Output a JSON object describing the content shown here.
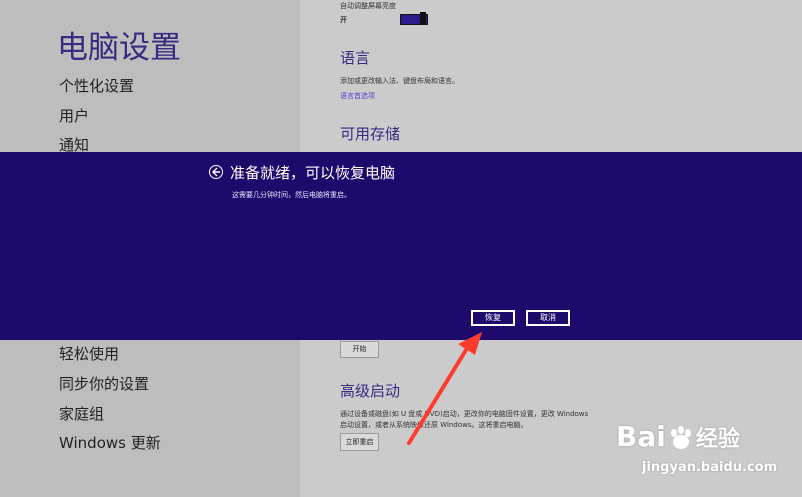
{
  "left": {
    "title": "电脑设置",
    "nav_top": [
      "个性化设置",
      "用户",
      "通知"
    ],
    "nav_bottom": [
      "轻松使用",
      "同步你的设置",
      "家庭组",
      "Windows 更新"
    ]
  },
  "right": {
    "brightness_label": "自动调整屏幕亮度",
    "toggle_state": "开",
    "language_heading": "语言",
    "language_desc": "添加或更改输入法、键盘布局和语言。",
    "language_link": "语言首选项",
    "storage_heading": "可用存储",
    "start_button": "开始",
    "advanced_heading": "高级启动",
    "advanced_desc_1": "通过设备或磁盘(如 U 盘或 DVD)启动，更改你的电脑固件设置，更改 Windows",
    "advanced_desc_2": "启动设置，或者从系统映像还原 Windows。这将重启电脑。",
    "restart_button": "立即重启"
  },
  "dialog": {
    "title": "准备就绪，可以恢复电脑",
    "subtitle": "这需要几分钟时间，然后电脑将重启。",
    "restore_button": "恢复",
    "cancel_button": "取消"
  },
  "watermark": {
    "brand": "Bai",
    "brand_suffix": "经验",
    "url": "jingyan.baidu.com"
  },
  "colors": {
    "overlay": "#1e0a6b",
    "accent": "#3a2a80",
    "arrow": "#ff3b30"
  }
}
